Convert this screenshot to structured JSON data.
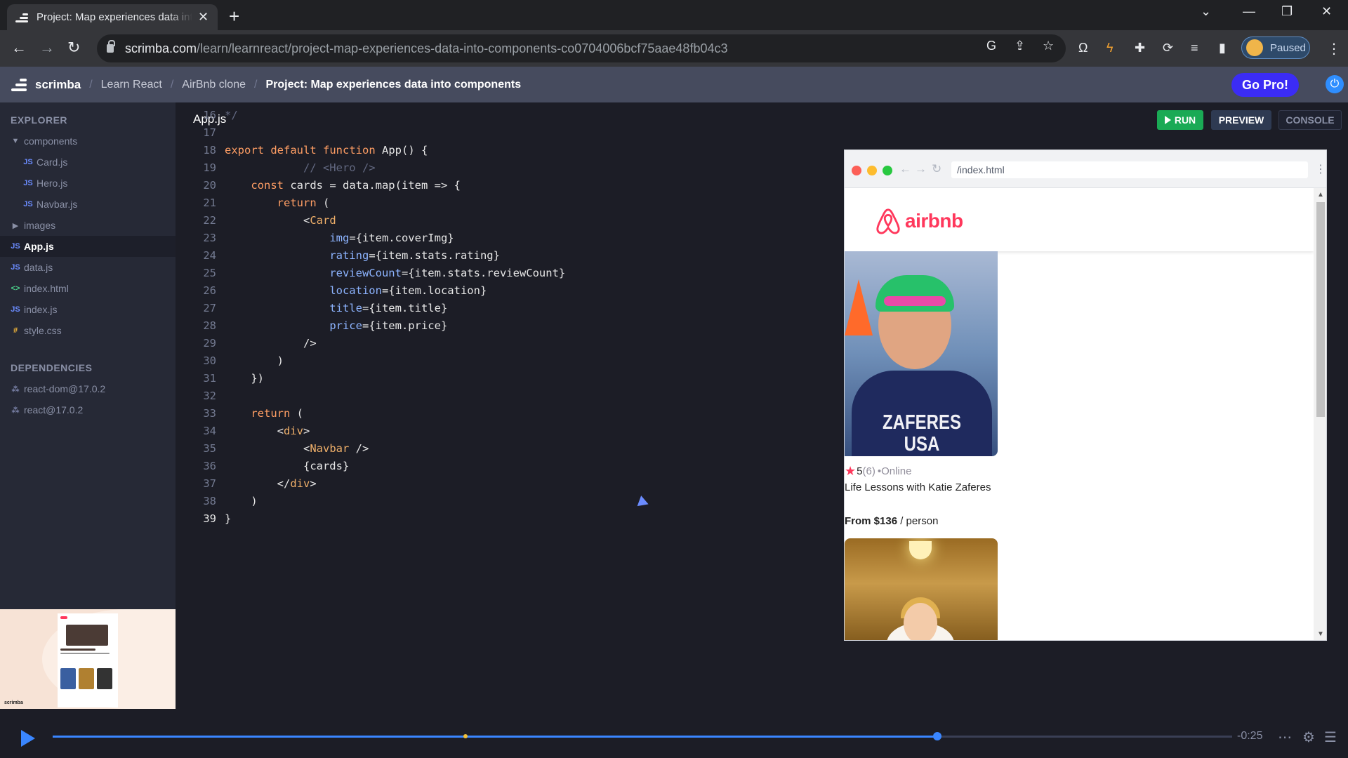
{
  "browser": {
    "tab_title": "Project: Map experiences data into components",
    "url_host": "scrimba.com",
    "url_path": "/learn/learnreact/project-map-experiences-data-into-components-co0704006bcf75aae48fb04c3",
    "profile_status": "Paused"
  },
  "header": {
    "brand": "scrimba",
    "breadcrumbs": [
      "Learn React",
      "AirBnb clone"
    ],
    "current": "Project: Map experiences data into components",
    "go_pro": "Go Pro!"
  },
  "sidebar": {
    "explorer_heading": "EXPLORER",
    "dependencies_heading": "DEPENDENCIES",
    "files": [
      {
        "label": "components",
        "icon": "folder-open-icon",
        "depth": 0
      },
      {
        "label": "Card.js",
        "icon": "js-file-icon",
        "depth": 1
      },
      {
        "label": "Hero.js",
        "icon": "js-file-icon",
        "depth": 1
      },
      {
        "label": "Navbar.js",
        "icon": "js-file-icon",
        "depth": 1
      },
      {
        "label": "images",
        "icon": "folder-closed-icon",
        "depth": 0
      },
      {
        "label": "App.js",
        "icon": "js-file-icon",
        "depth": 0,
        "active": true
      },
      {
        "label": "data.js",
        "icon": "js-file-icon",
        "depth": 0
      },
      {
        "label": "index.html",
        "icon": "html-file-icon",
        "depth": 0
      },
      {
        "label": "index.js",
        "icon": "js-file-icon",
        "depth": 0
      },
      {
        "label": "style.css",
        "icon": "css-file-icon",
        "depth": 0
      }
    ],
    "dependencies": [
      "react-dom@17.0.2",
      "react@17.0.2"
    ]
  },
  "editor": {
    "filename": "App.js",
    "first_line": 16,
    "current_line": 39,
    "lines": [
      "*/",
      "",
      "export default function App() {",
      "            // <Hero />",
      "    const cards = data.map(item => {",
      "        return (",
      "            <Card",
      "                img={item.coverImg}",
      "                rating={item.stats.rating}",
      "                reviewCount={item.stats.reviewCount}",
      "                location={item.location}",
      "                title={item.title}",
      "                price={item.price}",
      "            />",
      "        )",
      "    })",
      "",
      "    return (",
      "        <div>",
      "            <Navbar />",
      "            {cards}",
      "        </div>",
      "    )",
      "}"
    ]
  },
  "actions": {
    "run": "RUN",
    "preview": "PREVIEW",
    "console": "CONSOLE"
  },
  "preview": {
    "url": "/index.html",
    "brand_word": "airbnb",
    "card": {
      "jersey_text_line1": "ZAFERES",
      "jersey_text_line2": "USA",
      "rating": "5",
      "review_count": "(6)",
      "location": "•Online",
      "title": "Life Lessons with Katie Zaferes",
      "price": "From $136",
      "price_unit": " / person"
    }
  },
  "player": {
    "time_remaining": "-0:25",
    "progress": 0.75,
    "marker": 0.35
  },
  "colors": {
    "accent": "#3a86ff",
    "airbnb": "#ff385c",
    "run": "#1aaa55",
    "go_pro": "#3b2cf5"
  }
}
